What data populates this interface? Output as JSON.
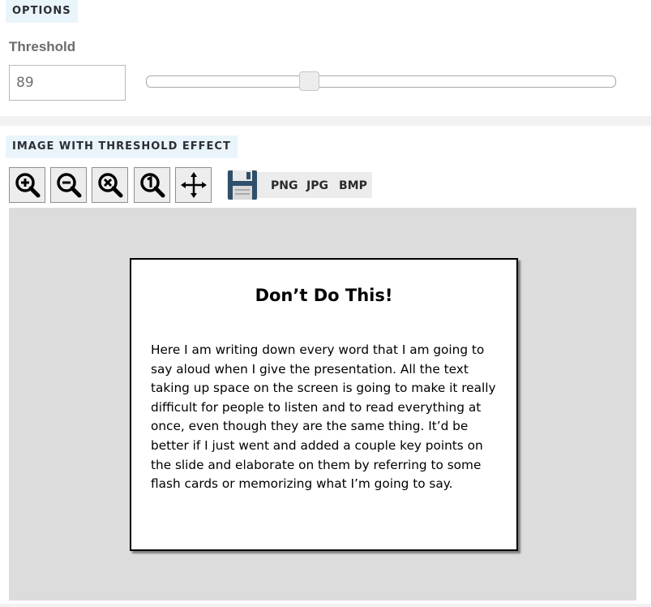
{
  "options": {
    "badge": "OPTIONS",
    "threshold_label": "Threshold",
    "threshold_value": "89",
    "slider_value": 89,
    "slider_min": 0,
    "slider_max": 255
  },
  "image_section": {
    "badge": "IMAGE WITH THRESHOLD EFFECT",
    "toolbar": {
      "icons": [
        "zoom-in-icon",
        "zoom-out-icon",
        "zoom-reset-icon",
        "zoom-actual-size-icon",
        "move-icon",
        "save-icon"
      ],
      "formats": [
        "PNG",
        "JPG",
        "BMP"
      ]
    },
    "slide": {
      "title": "Don’t Do This!",
      "body": "Here I am writing down every word that I am going to say aloud when I give the presentation. All the text taking up space on the screen is going to make it really difficult for people to listen and to read everything at once, even though they are the same thing. It’d be better if I just went and added a couple key points on the slide and elaborate on them by referring to some flash cards or memorizing what I’m going to say."
    }
  },
  "colors": {
    "badge_bg": "#eaf4fb",
    "canvas_bg": "#dcdcdc",
    "button_bg": "#ededed"
  }
}
